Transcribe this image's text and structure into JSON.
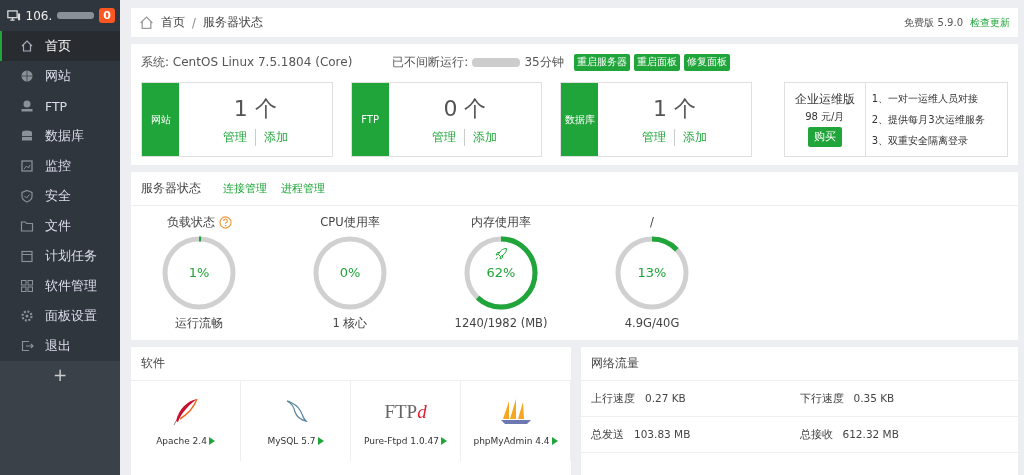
{
  "sidebar": {
    "host": "106.",
    "alerts": "0",
    "items": [
      {
        "label": "首页",
        "selected": true
      },
      {
        "label": "网站",
        "selected": false
      },
      {
        "label": "FTP",
        "selected": false
      },
      {
        "label": "数据库",
        "selected": false
      },
      {
        "label": "监控",
        "selected": false
      },
      {
        "label": "安全",
        "selected": false
      },
      {
        "label": "文件",
        "selected": false
      },
      {
        "label": "计划任务",
        "selected": false
      },
      {
        "label": "软件管理",
        "selected": false
      },
      {
        "label": "面板设置",
        "selected": false
      },
      {
        "label": "退出",
        "selected": false
      }
    ],
    "add": "+"
  },
  "breadcrumb": {
    "items": [
      "首页",
      "服务器状态"
    ],
    "separator": "/",
    "version": "免费版 5.9.0",
    "update_link": "检查更新"
  },
  "system": {
    "os": "系统: CentOS Linux 7.5.1804 (Core)",
    "uptime_label": "已不间断运行:",
    "uptime_value": "35分钟",
    "buttons": [
      "重启服务器",
      "重启面板",
      "修复面板"
    ]
  },
  "stat_cards": [
    {
      "label": "网站",
      "count": "1 个",
      "links": [
        "管理",
        "添加"
      ]
    },
    {
      "label": "FTP",
      "count": "0 个",
      "links": [
        "管理",
        "添加"
      ]
    },
    {
      "label": "数据库",
      "count": "1 个",
      "links": [
        "管理",
        "添加"
      ]
    }
  ],
  "enterprise": {
    "title": "企业运维版",
    "price": "98 元/月",
    "button": "购买",
    "features": [
      "1、一对一运维人员对接",
      "2、提供每月3次运维服务",
      "3、双重安全隔离登录"
    ]
  },
  "server_status": {
    "title": "服务器状态",
    "links": [
      "连接管理",
      "进程管理"
    ],
    "gauges": [
      {
        "title": "负载状态",
        "help": true,
        "rocket": false,
        "level": 0.01,
        "value": "1%",
        "caption": "运行流畅"
      },
      {
        "title": "CPU使用率",
        "help": false,
        "rocket": false,
        "level": 0,
        "value": "0%",
        "caption": "1 核心"
      },
      {
        "title": "内存使用率",
        "help": false,
        "rocket": true,
        "level": 0.62,
        "value": "62%",
        "caption": "1240/1982 (MB)"
      },
      {
        "title": "/",
        "help": false,
        "rocket": false,
        "level": 0.13,
        "value": "13%",
        "caption": "4.9G/40G"
      }
    ]
  },
  "software": {
    "title": "软件",
    "items": [
      {
        "kind": "feather",
        "name": "Apache 2.4"
      },
      {
        "kind": "dolphin",
        "name": "MySQL 5.7"
      },
      {
        "kind": "wordmark",
        "logo": "FTP",
        "logo_suffix": "d",
        "name": "Pure-Ftpd 1.0.47"
      },
      {
        "kind": "sailboat",
        "name": "phpMyAdmin 4.4"
      }
    ]
  },
  "network": {
    "title": "网络流量",
    "rows": [
      [
        {
          "label": "上行速度",
          "value": "0.27 KB"
        },
        {
          "label": "下行速度",
          "value": "0.35 KB"
        }
      ],
      [
        {
          "label": "总发送",
          "value": "103.83 MB"
        },
        {
          "label": "总接收",
          "value": "612.32 MB"
        }
      ]
    ]
  }
}
